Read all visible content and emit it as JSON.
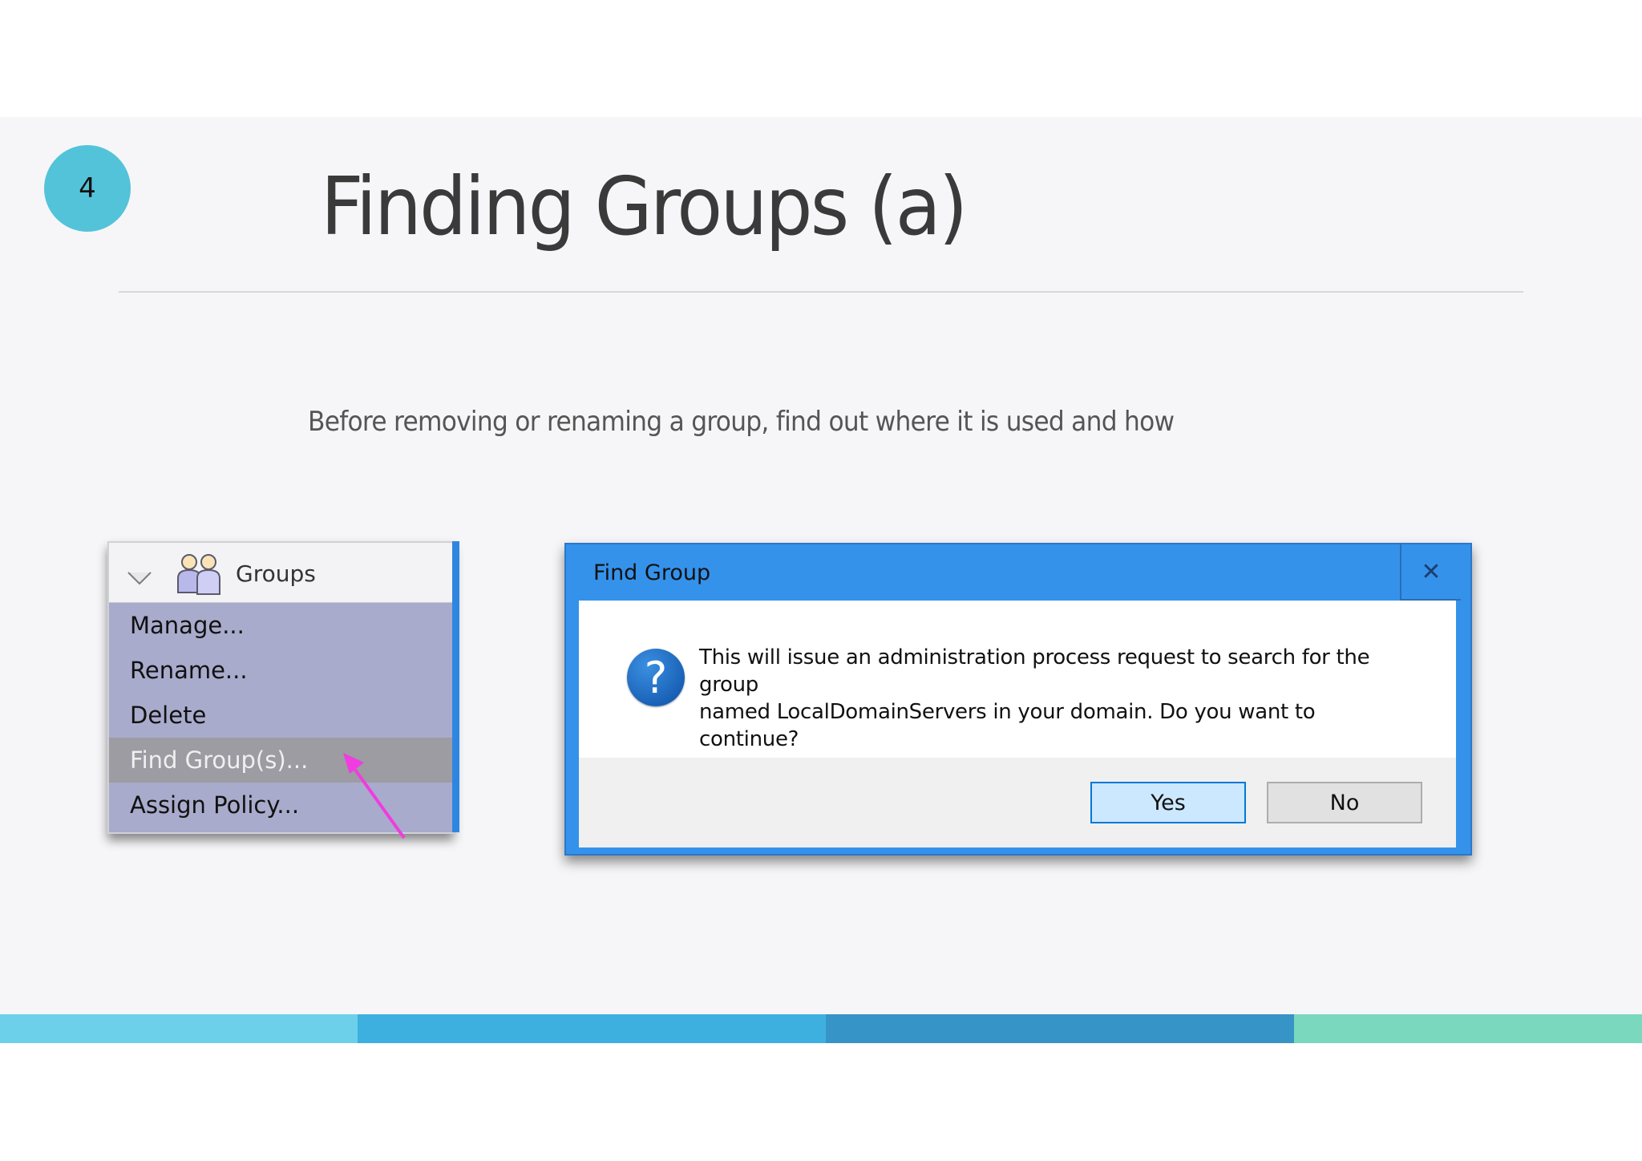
{
  "slide": {
    "number": "4",
    "title": "Finding Groups (a)",
    "subtitle": "Before removing or renaming a group, find out where it is used and how"
  },
  "menu": {
    "header_label": "Groups",
    "items": [
      {
        "label": "Manage..."
      },
      {
        "label": "Rename..."
      },
      {
        "label": "Delete"
      },
      {
        "label": "Find Group(s)..."
      },
      {
        "label": "Assign Policy..."
      }
    ],
    "selected_index": 3
  },
  "dialog": {
    "title": "Find Group",
    "close_glyph": "✕",
    "message_line1": "This will issue an administration process request to search for the group",
    "message_line2": "named LocalDomainServers in your domain.  Do you want to continue?",
    "yes_label": "Yes",
    "no_label": "No"
  },
  "colors": {
    "accent_circle": "#53c3d9",
    "menu_bg": "#a9abcc",
    "menu_selected": "#9c9ca2",
    "dialog_frame": "#3592eb",
    "arrow": "#f03ce0",
    "bar_segments": [
      "#6cd0ea",
      "#3eb0e0",
      "#3694c6",
      "#7ad8bf"
    ]
  }
}
